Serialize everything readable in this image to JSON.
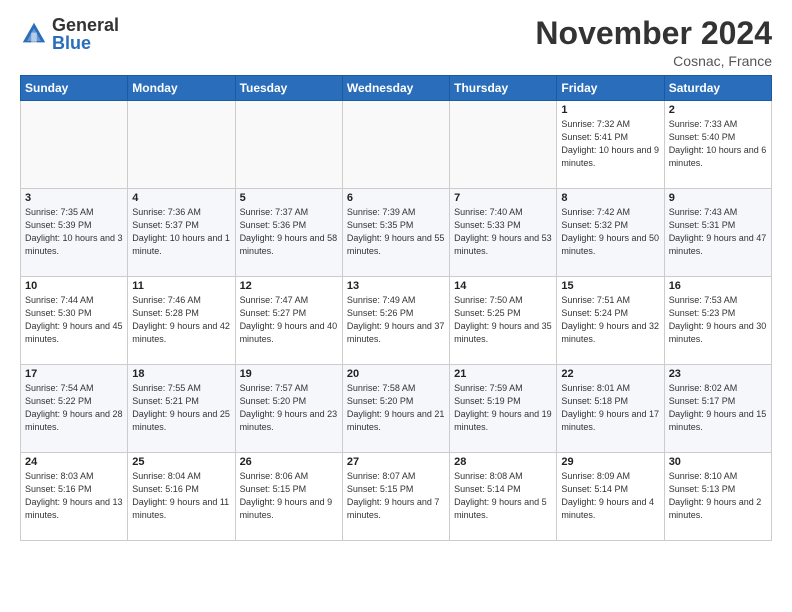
{
  "logo": {
    "general": "General",
    "blue": "Blue"
  },
  "header": {
    "month": "November 2024",
    "location": "Cosnac, France"
  },
  "weekdays": [
    "Sunday",
    "Monday",
    "Tuesday",
    "Wednesday",
    "Thursday",
    "Friday",
    "Saturday"
  ],
  "weeks": [
    [
      {
        "day": "",
        "info": ""
      },
      {
        "day": "",
        "info": ""
      },
      {
        "day": "",
        "info": ""
      },
      {
        "day": "",
        "info": ""
      },
      {
        "day": "",
        "info": ""
      },
      {
        "day": "1",
        "info": "Sunrise: 7:32 AM\nSunset: 5:41 PM\nDaylight: 10 hours and 9 minutes."
      },
      {
        "day": "2",
        "info": "Sunrise: 7:33 AM\nSunset: 5:40 PM\nDaylight: 10 hours and 6 minutes."
      }
    ],
    [
      {
        "day": "3",
        "info": "Sunrise: 7:35 AM\nSunset: 5:39 PM\nDaylight: 10 hours and 3 minutes."
      },
      {
        "day": "4",
        "info": "Sunrise: 7:36 AM\nSunset: 5:37 PM\nDaylight: 10 hours and 1 minute."
      },
      {
        "day": "5",
        "info": "Sunrise: 7:37 AM\nSunset: 5:36 PM\nDaylight: 9 hours and 58 minutes."
      },
      {
        "day": "6",
        "info": "Sunrise: 7:39 AM\nSunset: 5:35 PM\nDaylight: 9 hours and 55 minutes."
      },
      {
        "day": "7",
        "info": "Sunrise: 7:40 AM\nSunset: 5:33 PM\nDaylight: 9 hours and 53 minutes."
      },
      {
        "day": "8",
        "info": "Sunrise: 7:42 AM\nSunset: 5:32 PM\nDaylight: 9 hours and 50 minutes."
      },
      {
        "day": "9",
        "info": "Sunrise: 7:43 AM\nSunset: 5:31 PM\nDaylight: 9 hours and 47 minutes."
      }
    ],
    [
      {
        "day": "10",
        "info": "Sunrise: 7:44 AM\nSunset: 5:30 PM\nDaylight: 9 hours and 45 minutes."
      },
      {
        "day": "11",
        "info": "Sunrise: 7:46 AM\nSunset: 5:28 PM\nDaylight: 9 hours and 42 minutes."
      },
      {
        "day": "12",
        "info": "Sunrise: 7:47 AM\nSunset: 5:27 PM\nDaylight: 9 hours and 40 minutes."
      },
      {
        "day": "13",
        "info": "Sunrise: 7:49 AM\nSunset: 5:26 PM\nDaylight: 9 hours and 37 minutes."
      },
      {
        "day": "14",
        "info": "Sunrise: 7:50 AM\nSunset: 5:25 PM\nDaylight: 9 hours and 35 minutes."
      },
      {
        "day": "15",
        "info": "Sunrise: 7:51 AM\nSunset: 5:24 PM\nDaylight: 9 hours and 32 minutes."
      },
      {
        "day": "16",
        "info": "Sunrise: 7:53 AM\nSunset: 5:23 PM\nDaylight: 9 hours and 30 minutes."
      }
    ],
    [
      {
        "day": "17",
        "info": "Sunrise: 7:54 AM\nSunset: 5:22 PM\nDaylight: 9 hours and 28 minutes."
      },
      {
        "day": "18",
        "info": "Sunrise: 7:55 AM\nSunset: 5:21 PM\nDaylight: 9 hours and 25 minutes."
      },
      {
        "day": "19",
        "info": "Sunrise: 7:57 AM\nSunset: 5:20 PM\nDaylight: 9 hours and 23 minutes."
      },
      {
        "day": "20",
        "info": "Sunrise: 7:58 AM\nSunset: 5:20 PM\nDaylight: 9 hours and 21 minutes."
      },
      {
        "day": "21",
        "info": "Sunrise: 7:59 AM\nSunset: 5:19 PM\nDaylight: 9 hours and 19 minutes."
      },
      {
        "day": "22",
        "info": "Sunrise: 8:01 AM\nSunset: 5:18 PM\nDaylight: 9 hours and 17 minutes."
      },
      {
        "day": "23",
        "info": "Sunrise: 8:02 AM\nSunset: 5:17 PM\nDaylight: 9 hours and 15 minutes."
      }
    ],
    [
      {
        "day": "24",
        "info": "Sunrise: 8:03 AM\nSunset: 5:16 PM\nDaylight: 9 hours and 13 minutes."
      },
      {
        "day": "25",
        "info": "Sunrise: 8:04 AM\nSunset: 5:16 PM\nDaylight: 9 hours and 11 minutes."
      },
      {
        "day": "26",
        "info": "Sunrise: 8:06 AM\nSunset: 5:15 PM\nDaylight: 9 hours and 9 minutes."
      },
      {
        "day": "27",
        "info": "Sunrise: 8:07 AM\nSunset: 5:15 PM\nDaylight: 9 hours and 7 minutes."
      },
      {
        "day": "28",
        "info": "Sunrise: 8:08 AM\nSunset: 5:14 PM\nDaylight: 9 hours and 5 minutes."
      },
      {
        "day": "29",
        "info": "Sunrise: 8:09 AM\nSunset: 5:14 PM\nDaylight: 9 hours and 4 minutes."
      },
      {
        "day": "30",
        "info": "Sunrise: 8:10 AM\nSunset: 5:13 PM\nDaylight: 9 hours and 2 minutes."
      }
    ]
  ]
}
